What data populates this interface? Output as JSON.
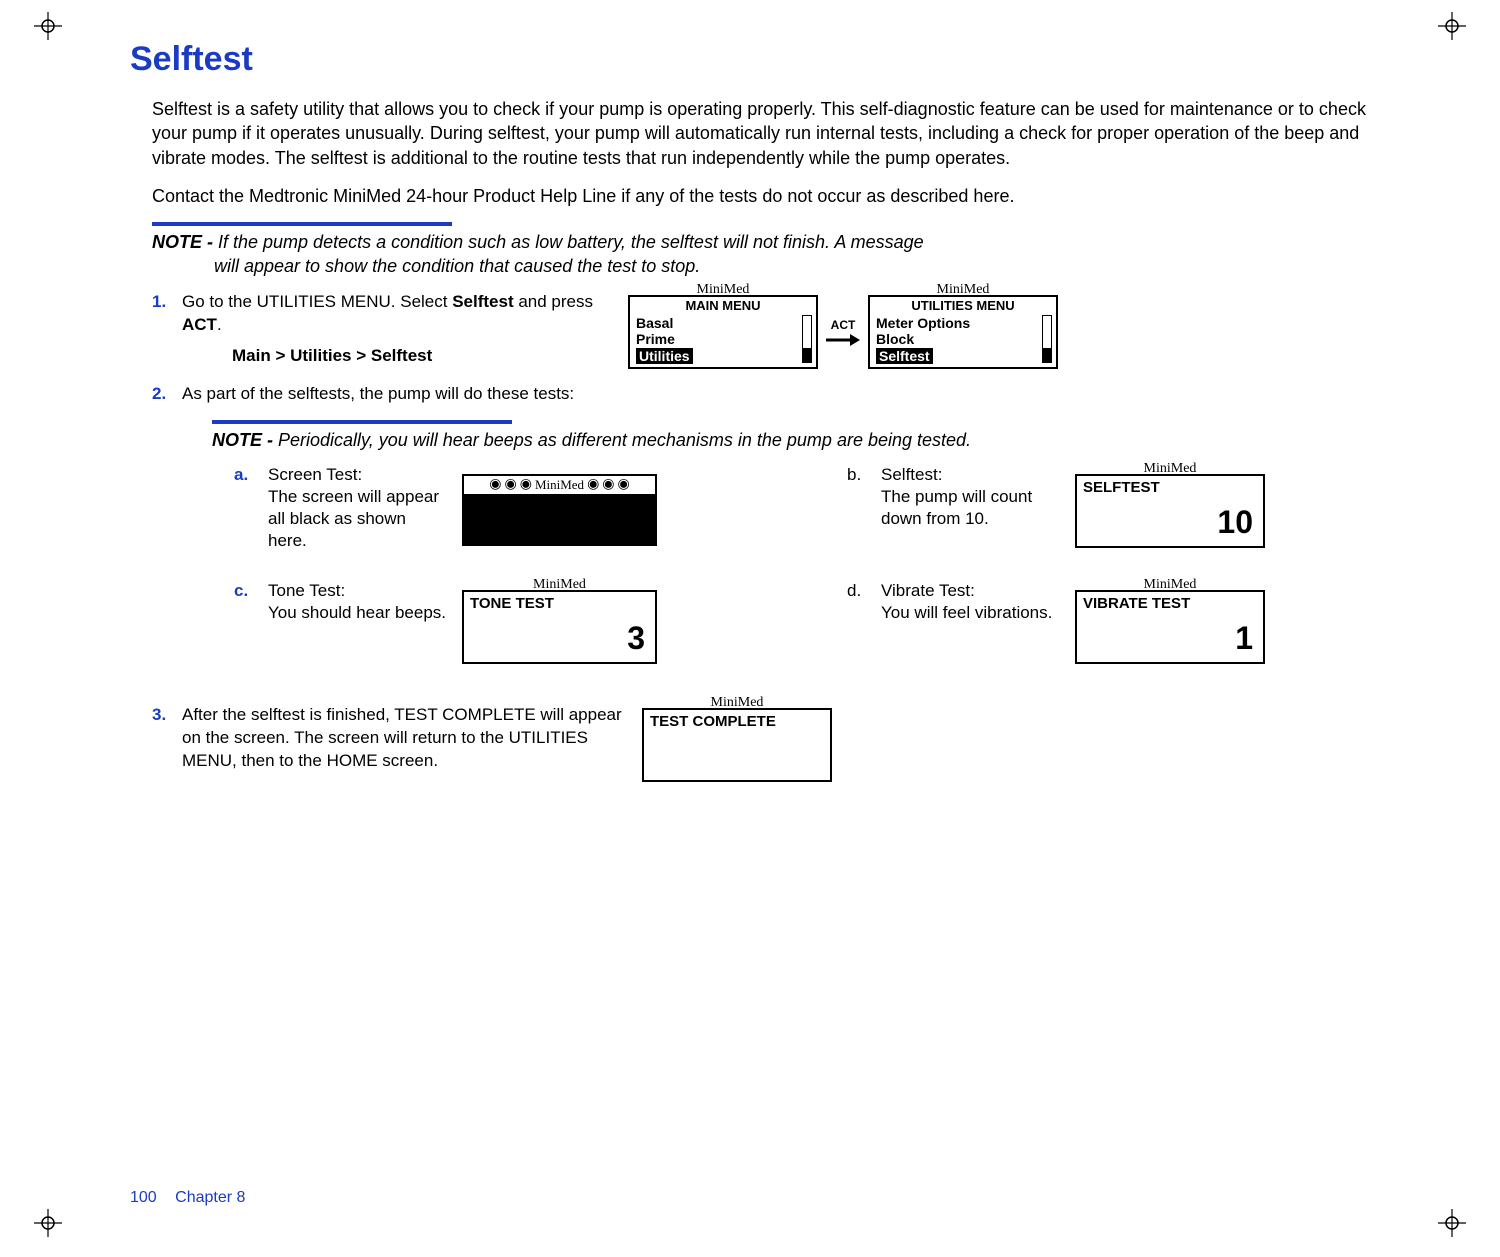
{
  "title": "Selftest",
  "intro_p1": "Selftest is a safety utility that allows you to check if your pump is operating properly. This self-diagnostic feature can be used for maintenance or to check your pump if it operates unusually. During selftest, your pump will automatically run internal tests, including a check for proper operation of the beep and vibrate modes. The selftest is additional to the routine tests that run independently while the pump operates.",
  "intro_p2": "Contact the Medtronic MiniMed 24-hour Product Help Line if any of the tests do not occur as described here.",
  "note1": {
    "label": "NOTE - ",
    "line1": "If the pump detects a condition such as low battery, the selftest will not finish. A message",
    "line2": "will appear to show the condition that caused the test to stop."
  },
  "steps": {
    "s1": {
      "num": "1.",
      "text_a": "Go to the UTILITIES MENU. Select ",
      "text_b": "Selftest",
      "text_c": " and press ",
      "text_d": "ACT",
      "text_e": ".",
      "breadcrumb": "Main > Utilities > Selftest"
    },
    "s2": {
      "num": "2.",
      "text": "As part of the selftests, the pump will do these tests:"
    },
    "s3": {
      "num": "3.",
      "text": "After the selftest is finished, TEST COMPLETE will appear on the screen. The screen will return to the UTILITIES MENU, then to the HOME screen."
    }
  },
  "note2": {
    "label": "NOTE - ",
    "body": "Periodically, you will hear beeps as different mechanisms in the pump are being tested."
  },
  "menus": {
    "brand": "MiniMed",
    "act_label": "ACT",
    "main": {
      "title": "MAIN MENU",
      "item1": "Basal",
      "item2": "Prime",
      "item3": "Utilities"
    },
    "util": {
      "title": "UTILITIES MENU",
      "item1": "Meter Options",
      "item2": "Block",
      "item3": "Selftest"
    }
  },
  "tests": {
    "a": {
      "marker": "a.",
      "title": "Screen Test:",
      "body": "The screen will appear all black as shown here.",
      "strip_label": "MiniMed"
    },
    "b": {
      "marker": "b.",
      "title": "Selftest:",
      "body": "The pump will count down from 10.",
      "screen_title": "SELFTEST",
      "value": "10"
    },
    "c": {
      "marker": "c.",
      "title": "Tone Test:",
      "body": "You should hear beeps.",
      "screen_title": "TONE TEST",
      "value": "3"
    },
    "d": {
      "marker": "d.",
      "title": "Vibrate Test:",
      "body": "You will feel vibrations.",
      "screen_title": "VIBRATE TEST",
      "value": "1"
    }
  },
  "complete": {
    "screen_title": "TEST COMPLETE"
  },
  "footer": {
    "page": "100",
    "chapter": "Chapter 8"
  }
}
